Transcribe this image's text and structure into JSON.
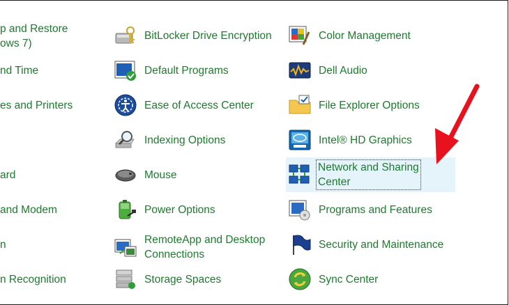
{
  "col0": [
    {
      "lines": [
        "p and Restore",
        "ows 7)"
      ]
    },
    {
      "lines": [
        "nd Time"
      ]
    },
    {
      "lines": [
        "es and Printers"
      ]
    },
    {
      "lines": [
        "ard"
      ]
    },
    {
      "lines": [
        "and Modem"
      ]
    },
    {
      "lines": [
        "n"
      ]
    },
    {
      "lines": [
        "n Recognition"
      ]
    }
  ],
  "col1": [
    {
      "label": "BitLocker Drive Encryption",
      "icon": "bitlocker-icon"
    },
    {
      "label": "Default Programs",
      "icon": "default-programs-icon"
    },
    {
      "label": "Ease of Access Center",
      "icon": "ease-of-access-icon"
    },
    {
      "label": "Indexing Options",
      "icon": "indexing-options-icon"
    },
    {
      "label": "Mouse",
      "icon": "mouse-icon"
    },
    {
      "label": "Power Options",
      "icon": "power-options-icon"
    },
    {
      "label": "RemoteApp and Desktop Connections",
      "line1": "RemoteApp and Desktop",
      "line2": "Connections",
      "icon": "remoteapp-icon"
    },
    {
      "label": "Storage Spaces",
      "icon": "storage-spaces-icon"
    }
  ],
  "col2": [
    {
      "label": "Color Management",
      "icon": "color-management-icon"
    },
    {
      "label": "Dell Audio",
      "icon": "dell-audio-icon"
    },
    {
      "label": "File Explorer Options",
      "icon": "file-explorer-options-icon"
    },
    {
      "label": "Intel® HD Graphics",
      "icon": "intel-graphics-icon"
    },
    {
      "label": "Network and Sharing Center",
      "line1": "Network and Sharing",
      "line2": "Center",
      "icon": "network-sharing-icon",
      "selected": true
    },
    {
      "label": "Programs and Features",
      "icon": "programs-features-icon"
    },
    {
      "label": "Security and Maintenance",
      "icon": "security-maintenance-icon"
    },
    {
      "label": "Sync Center",
      "icon": "sync-center-icon"
    }
  ],
  "colors": {
    "link": "#1e7a2e",
    "selection": "#e5f3fb",
    "arrow": "#e8121f"
  }
}
